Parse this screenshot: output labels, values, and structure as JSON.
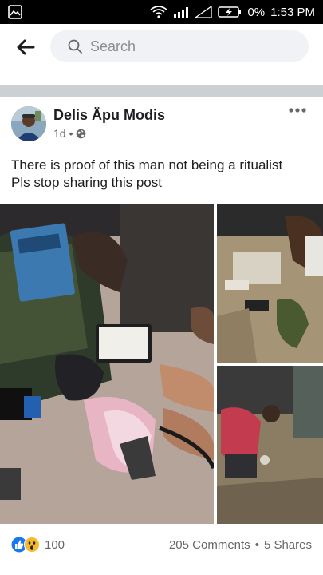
{
  "status_bar": {
    "battery": "0%",
    "time": "1:53 PM"
  },
  "search": {
    "placeholder": "Search"
  },
  "post": {
    "author": "Delis Äpu Modis",
    "time_ago": "1d",
    "separator": "•",
    "text_line1": "There is proof of this man not being a ritualist",
    "text_line2": "Pls stop sharing this post",
    "reaction_count": "100",
    "comments": "205 Comments",
    "stats_separator": "•",
    "shares": "5 Shares"
  },
  "colors": {
    "status_bar_bg": "#000000",
    "search_pill_bg": "#f0f2f5",
    "separator_gray": "#ccd0d5",
    "like_blue": "#1877f2",
    "wow_yellow": "#f7b928",
    "meta_gray": "#65676b"
  },
  "icons": {
    "status_left": "gallery-icon",
    "wifi": "wifi-icon",
    "signal": "signal-icon",
    "battery": "battery-icon",
    "back": "back-arrow-icon",
    "search": "search-icon",
    "privacy": "globe-icon",
    "more": "more-icon",
    "like": "like-reaction-icon",
    "wow": "wow-reaction-icon"
  }
}
